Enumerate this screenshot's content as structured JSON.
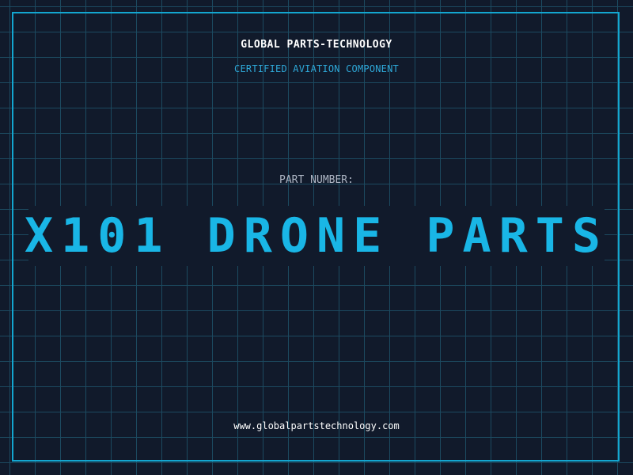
{
  "header": {
    "company": "GLOBAL PARTS-TECHNOLOGY",
    "subtitle": "CERTIFIED AVIATION COMPONENT"
  },
  "main": {
    "part_label": "PART NUMBER:",
    "part_number": "X101 DRONE PARTS"
  },
  "footer": {
    "url": "www.globalpartstechnology.com"
  },
  "colors": {
    "background": "#111a2b",
    "grid": "#1c4a60",
    "accent": "#19b6e6",
    "frame": "#13a6d0"
  }
}
